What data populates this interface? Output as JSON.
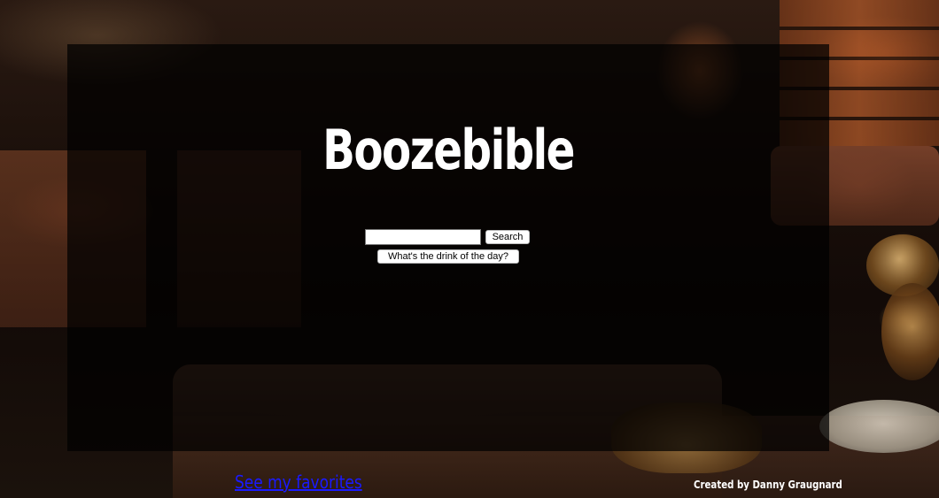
{
  "app": {
    "title": "Boozebible"
  },
  "search": {
    "value": "",
    "placeholder": "",
    "button_label": "Search"
  },
  "drink_of_day": {
    "button_label": "What's the drink of the day?"
  },
  "footer": {
    "favorites_link": "See my favorites",
    "credit": "Created by Danny Graugnard"
  },
  "colors": {
    "title": "#ffffff",
    "link": "#1a1aff",
    "overlay": "rgba(0,0,0,0.72)"
  }
}
